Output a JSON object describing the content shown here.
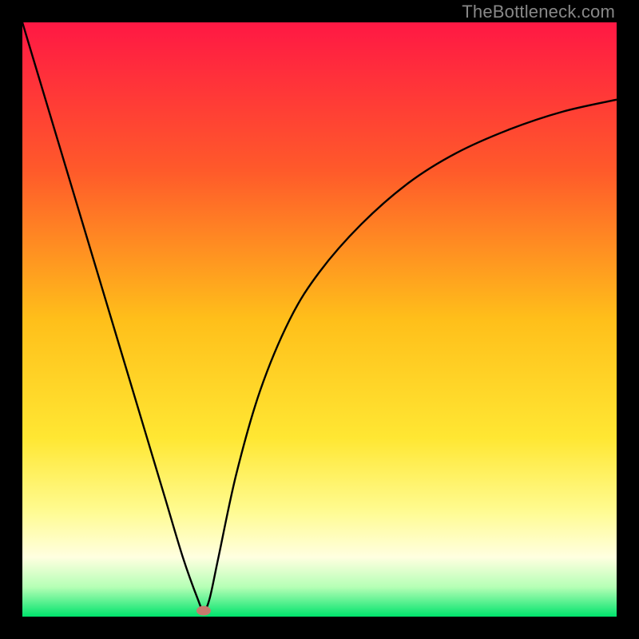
{
  "watermark": "TheBottleneck.com",
  "chart_data": {
    "type": "line",
    "title": "",
    "xlabel": "",
    "ylabel": "",
    "xlim": [
      0,
      100
    ],
    "ylim": [
      0,
      100
    ],
    "background": {
      "type": "vertical-gradient",
      "stops": [
        {
          "offset": 0,
          "color": "#ff1844"
        },
        {
          "offset": 25,
          "color": "#ff5a2a"
        },
        {
          "offset": 50,
          "color": "#ffbf1a"
        },
        {
          "offset": 70,
          "color": "#ffe733"
        },
        {
          "offset": 82,
          "color": "#fffb8f"
        },
        {
          "offset": 90,
          "color": "#ffffe0"
        },
        {
          "offset": 95,
          "color": "#b6ffb6"
        },
        {
          "offset": 100,
          "color": "#00e36c"
        }
      ]
    },
    "series": [
      {
        "name": "bottleneck-curve",
        "x": [
          0,
          3,
          6,
          9,
          12,
          15,
          18,
          21,
          24,
          27,
          29.5,
          30.5,
          31.5,
          33,
          36,
          40,
          45,
          50,
          57,
          65,
          73,
          82,
          91,
          100
        ],
        "y": [
          100,
          90,
          80,
          70,
          60,
          50,
          40,
          30,
          20,
          10,
          3,
          1,
          3,
          10,
          24,
          38,
          50,
          58,
          66,
          73,
          78,
          82,
          85,
          87
        ]
      }
    ],
    "marker": {
      "name": "optimal-point",
      "x": 30.5,
      "y": 1,
      "color": "#c77a6e",
      "rx": 9,
      "ry": 6
    }
  }
}
